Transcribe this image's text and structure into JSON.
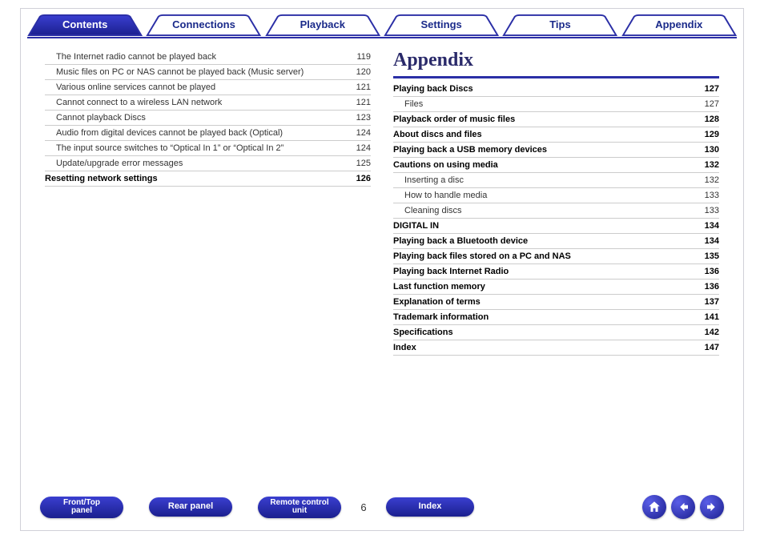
{
  "tabs": [
    {
      "label": "Contents",
      "active": true
    },
    {
      "label": "Connections",
      "active": false
    },
    {
      "label": "Playback",
      "active": false
    },
    {
      "label": "Settings",
      "active": false
    },
    {
      "label": "Tips",
      "active": false
    },
    {
      "label": "Appendix",
      "active": false
    }
  ],
  "left_col": [
    {
      "label": "The Internet radio cannot be played back",
      "page": "119",
      "bold": false,
      "indent": 1
    },
    {
      "label": "Music files on PC or NAS cannot be played back (Music server)",
      "page": "120",
      "bold": false,
      "indent": 1
    },
    {
      "label": "Various online services cannot be played",
      "page": "121",
      "bold": false,
      "indent": 1
    },
    {
      "label": "Cannot connect to a wireless LAN network",
      "page": "121",
      "bold": false,
      "indent": 1
    },
    {
      "label": "Cannot playback Discs",
      "page": "123",
      "bold": false,
      "indent": 1
    },
    {
      "label": "Audio from digital devices cannot be played back (Optical)",
      "page": "124",
      "bold": false,
      "indent": 1
    },
    {
      "label": "The input source switches to “Optical In 1” or “Optical In 2”",
      "page": "124",
      "bold": false,
      "indent": 1
    },
    {
      "label": "Update/upgrade error messages",
      "page": "125",
      "bold": false,
      "indent": 1
    },
    {
      "label": "Resetting network settings",
      "page": "126",
      "bold": true,
      "indent": 0
    }
  ],
  "right_title": "Appendix",
  "right_col": [
    {
      "label": "Playing back Discs",
      "page": "127",
      "bold": true,
      "indent": 0
    },
    {
      "label": "Files",
      "page": "127",
      "bold": false,
      "indent": 1
    },
    {
      "label": "Playback order of music files",
      "page": "128",
      "bold": true,
      "indent": 0
    },
    {
      "label": "About discs and files",
      "page": "129",
      "bold": true,
      "indent": 0
    },
    {
      "label": "Playing back a USB memory devices",
      "page": "130",
      "bold": true,
      "indent": 0
    },
    {
      "label": "Cautions on using media",
      "page": "132",
      "bold": true,
      "indent": 0
    },
    {
      "label": "Inserting a disc",
      "page": "132",
      "bold": false,
      "indent": 1
    },
    {
      "label": "How to handle media",
      "page": "133",
      "bold": false,
      "indent": 1
    },
    {
      "label": "Cleaning discs",
      "page": "133",
      "bold": false,
      "indent": 1
    },
    {
      "label": "DIGITAL IN",
      "page": "134",
      "bold": true,
      "indent": 0
    },
    {
      "label": "Playing back a Bluetooth device",
      "page": "134",
      "bold": true,
      "indent": 0
    },
    {
      "label": "Playing back files stored on a PC and NAS",
      "page": "135",
      "bold": true,
      "indent": 0
    },
    {
      "label": "Playing back Internet Radio",
      "page": "136",
      "bold": true,
      "indent": 0
    },
    {
      "label": "Last function memory",
      "page": "136",
      "bold": true,
      "indent": 0
    },
    {
      "label": "Explanation of terms",
      "page": "137",
      "bold": true,
      "indent": 0
    },
    {
      "label": "Trademark information",
      "page": "141",
      "bold": true,
      "indent": 0
    },
    {
      "label": "Specifications",
      "page": "142",
      "bold": true,
      "indent": 0
    },
    {
      "label": "Index",
      "page": "147",
      "bold": true,
      "indent": 0
    }
  ],
  "footer": {
    "buttons": [
      {
        "label": "Front/Top\npanel"
      },
      {
        "label": "Rear panel"
      },
      {
        "label": "Remote control\nunit"
      }
    ],
    "page_number": "6",
    "index_label": "Index",
    "nav": {
      "home": "home-icon",
      "prev": "arrow-left-icon",
      "next": "arrow-right-icon"
    }
  }
}
